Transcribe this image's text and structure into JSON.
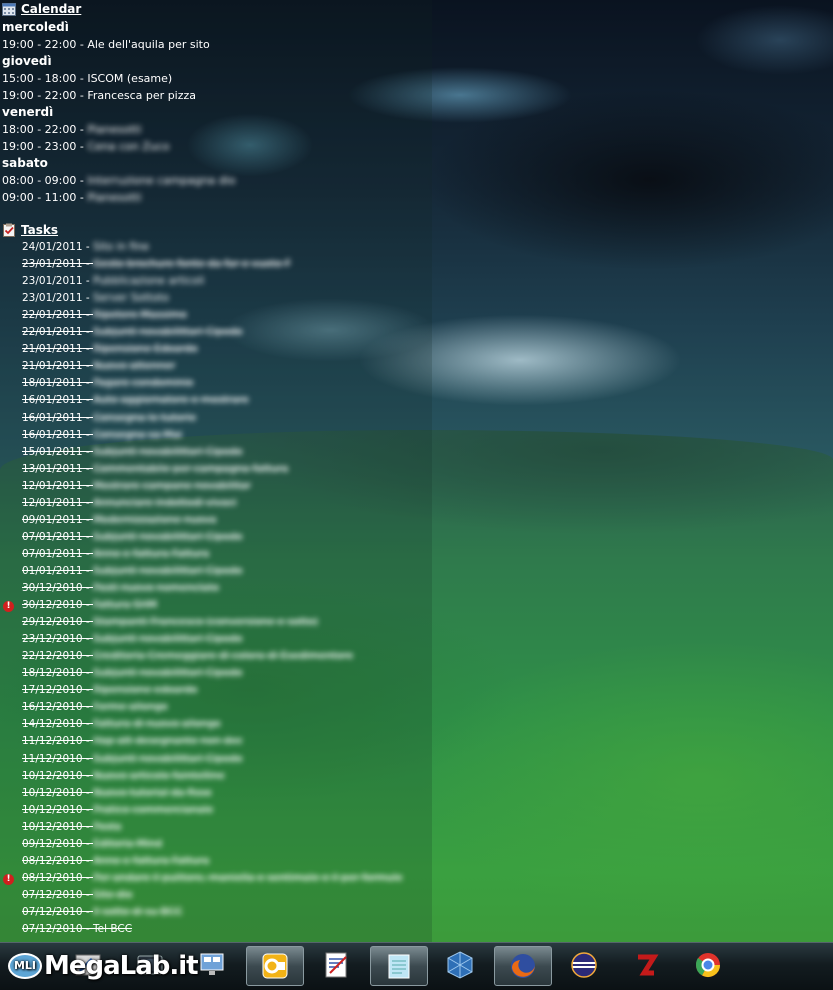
{
  "calendar": {
    "title": "Calendar",
    "days": [
      {
        "name": "mercoledì",
        "events": [
          {
            "time": "19:00 - 22:00 - ",
            "text": "Ale dell'aquila per sito",
            "blurred": false
          }
        ]
      },
      {
        "name": "giovedì",
        "events": [
          {
            "time": "15:00 - 18:00 - ",
            "text": "ISCOM (esame)",
            "blurred": false
          },
          {
            "time": "19:00 - 22:00 - ",
            "text": "Francesca per pizza",
            "blurred": false
          }
        ]
      },
      {
        "name": "venerdì",
        "events": [
          {
            "time": "18:00 - 22:00 - ",
            "text": "Pianesotti",
            "blurred": true
          },
          {
            "time": "19:00 - 23:00 - ",
            "text": "Cena con Zuco",
            "blurred": true
          }
        ]
      },
      {
        "name": "sabato",
        "events": [
          {
            "time": "08:00 - 09:00 - ",
            "text": "Interruzione campagna dio",
            "blurred": true
          },
          {
            "time": "09:00 - 11:00 - ",
            "text": "Pianesotti",
            "blurred": true
          }
        ]
      }
    ]
  },
  "tasks": {
    "title": "Tasks",
    "items": [
      {
        "date": "24/01/2011",
        "text": "Sito in fine",
        "done": false,
        "priority": false
      },
      {
        "date": "23/01/2011",
        "text": "Gesto brochure fonte da far e vuoto F",
        "done": true,
        "priority": false
      },
      {
        "date": "23/01/2011",
        "text": "Pubblicazione articoli",
        "done": false,
        "priority": false
      },
      {
        "date": "23/01/2011",
        "text": "Server Sottoto",
        "done": false,
        "priority": false
      },
      {
        "date": "22/01/2011",
        "text": "Ripetere Massimo",
        "done": true,
        "priority": false
      },
      {
        "date": "22/01/2011",
        "text": "Subjunti novabilittari Cipodo",
        "done": true,
        "priority": false
      },
      {
        "date": "21/01/2011",
        "text": "Ripensione Edoardo",
        "done": true,
        "priority": false
      },
      {
        "date": "21/01/2011",
        "text": "Nuovo attenner",
        "done": true,
        "priority": false
      },
      {
        "date": "18/01/2011",
        "text": "Pagare condominio",
        "done": true,
        "priority": false
      },
      {
        "date": "16/01/2011",
        "text": "Auto aggiornatore e mostrare",
        "done": true,
        "priority": false
      },
      {
        "date": "16/01/2011",
        "text": "Consegna le tutorie",
        "done": true,
        "priority": false
      },
      {
        "date": "16/01/2011",
        "text": "Consegna sa Mai",
        "done": true,
        "priority": false
      },
      {
        "date": "15/01/2011",
        "text": "Subjunti novabilittari Cipodo",
        "done": true,
        "priority": false
      },
      {
        "date": "13/01/2011",
        "text": "Commentabile per campagna fattura",
        "done": true,
        "priority": false
      },
      {
        "date": "12/01/2011",
        "text": "Mostrare campane novabilitar",
        "done": true,
        "priority": false
      },
      {
        "date": "12/01/2011",
        "text": "Annunciare indottodi vivaci",
        "done": true,
        "priority": false
      },
      {
        "date": "09/01/2011",
        "text": "Modernizzazione nuova",
        "done": true,
        "priority": false
      },
      {
        "date": "07/01/2011",
        "text": "Subjunti novabilittari Cipodo",
        "done": true,
        "priority": false
      },
      {
        "date": "07/01/2011",
        "text": "Anno e fattura Fattura",
        "done": true,
        "priority": false
      },
      {
        "date": "01/01/2011",
        "text": "Subjunti novabilittari Cipodo",
        "done": true,
        "priority": false
      },
      {
        "date": "30/12/2010",
        "text": "Posti nuovo nomenclato",
        "done": true,
        "priority": false
      },
      {
        "date": "30/12/2010",
        "text": "Fattura SHM",
        "done": true,
        "priority": true
      },
      {
        "date": "29/12/2010",
        "text": "Stampanti Francesco (conversione e sotto)",
        "done": true,
        "priority": false
      },
      {
        "date": "23/12/2010",
        "text": "Subjunti novabilittari Cipodo",
        "done": true,
        "priority": false
      },
      {
        "date": "22/12/2010",
        "text": "Creditoria Cremeggiare di colora di Esedimentore",
        "done": true,
        "priority": false
      },
      {
        "date": "18/12/2010",
        "text": "Subjunti novabilittari Cipodo",
        "done": true,
        "priority": false
      },
      {
        "date": "17/12/2010",
        "text": "Ripensione edoardo",
        "done": true,
        "priority": false
      },
      {
        "date": "16/12/2010",
        "text": "Forme allongo",
        "done": true,
        "priority": false
      },
      {
        "date": "14/12/2010",
        "text": "Fattura di nuovo allongo",
        "done": true,
        "priority": false
      },
      {
        "date": "11/12/2010",
        "text": "Hap att desegnante non dec",
        "done": true,
        "priority": false
      },
      {
        "date": "11/12/2010",
        "text": "Subjunti novabilittari Cipodo",
        "done": true,
        "priority": false
      },
      {
        "date": "10/12/2010",
        "text": "Nuovo articolo faintelline",
        "done": true,
        "priority": false
      },
      {
        "date": "10/12/2010",
        "text": "Nuovo tutorial da fisso",
        "done": true,
        "priority": false
      },
      {
        "date": "10/12/2010",
        "text": "Pratico commercianale",
        "done": true,
        "priority": false
      },
      {
        "date": "10/12/2010",
        "text": "Posta",
        "done": true,
        "priority": false
      },
      {
        "date": "09/12/2010",
        "text": "Editoria Mind",
        "done": true,
        "priority": false
      },
      {
        "date": "08/12/2010",
        "text": "Anno e fattura Fattura",
        "done": true,
        "priority": false
      },
      {
        "date": "08/12/2010",
        "text": "Per andare il pulitore, maniella e sentimale e il per formule",
        "done": true,
        "priority": true
      },
      {
        "date": "07/12/2010",
        "text": "Sito dio",
        "done": true,
        "priority": false
      },
      {
        "date": "07/12/2010",
        "text": "Il sotto di su BCC",
        "done": true,
        "priority": false
      },
      {
        "date": "07/12/2010",
        "text": "Tel BCC",
        "done": true,
        "priority": false,
        "clear": true
      }
    ]
  },
  "taskbar": {
    "watermark": "MegaLab.it",
    "badge": "MLI",
    "apps": [
      {
        "name": "paint-app"
      },
      {
        "name": "media-app"
      },
      {
        "name": "network-app"
      },
      {
        "name": "outlook-app"
      },
      {
        "name": "editor-app"
      },
      {
        "name": "notepad-app"
      },
      {
        "name": "virtualbox-app"
      },
      {
        "name": "firefox-app"
      },
      {
        "name": "eclipse-app"
      },
      {
        "name": "filezilla-app"
      },
      {
        "name": "chrome-app"
      }
    ]
  },
  "colors": {
    "priority": "#d0201e",
    "accent": "#5ea6d6"
  }
}
